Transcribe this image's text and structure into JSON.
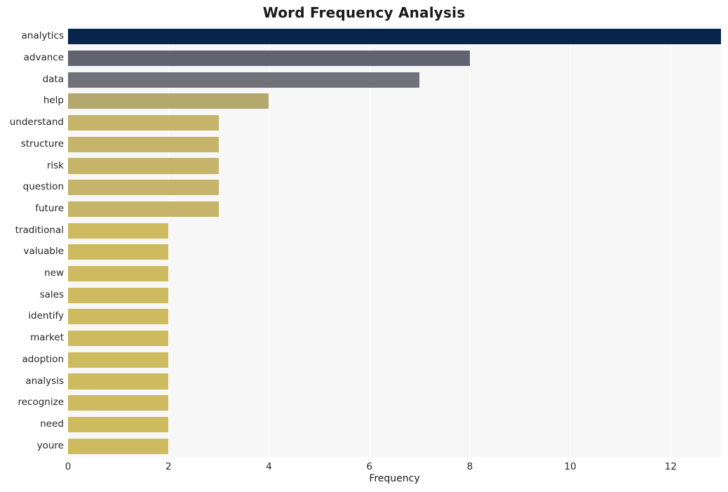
{
  "chart_data": {
    "type": "bar",
    "orientation": "horizontal",
    "title": "Word Frequency Analysis",
    "xlabel": "Frequency",
    "ylabel": "",
    "xlim": [
      0,
      13
    ],
    "xticks": [
      0,
      2,
      4,
      6,
      8,
      10,
      12
    ],
    "xtick_labels": [
      "0",
      "2",
      "4",
      "6",
      "8",
      "10",
      "12"
    ],
    "grid": "vertical",
    "legend": "none",
    "categories": [
      "analytics",
      "advance",
      "data",
      "help",
      "understand",
      "structure",
      "risk",
      "question",
      "future",
      "traditional",
      "valuable",
      "new",
      "sales",
      "identify",
      "market",
      "adoption",
      "analysis",
      "recognize",
      "need",
      "youre"
    ],
    "values": [
      13,
      8,
      7,
      4,
      3,
      3,
      3,
      3,
      3,
      2,
      2,
      2,
      2,
      2,
      2,
      2,
      2,
      2,
      2,
      2
    ],
    "bar_colors": [
      "#07244d",
      "#626370",
      "#71717a",
      "#b4a86f",
      "#c5b46a",
      "#c5b46a",
      "#c5b46a",
      "#c5b46a",
      "#c5b46a",
      "#ceba5f",
      "#ceba5f",
      "#ceba5f",
      "#ceba5f",
      "#ceba5f",
      "#ceba5f",
      "#ceba5f",
      "#ceba5f",
      "#ceba5f",
      "#ceba5f",
      "#ceba5f"
    ],
    "plot_background": "#f7f7f7",
    "grid_color": "#ffffff",
    "text_color": "#262626"
  }
}
